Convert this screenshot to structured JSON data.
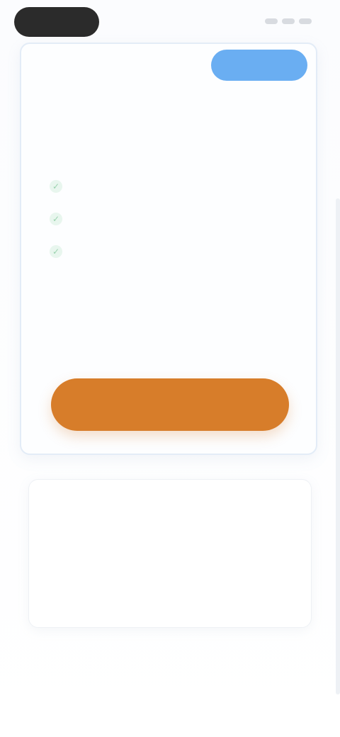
{
  "status_bar": {
    "time": "",
    "icons": [
      "signal-icon",
      "wifi-icon",
      "battery-icon"
    ]
  },
  "plan_card": {
    "label": "",
    "badge": "",
    "headline": "",
    "subline": "",
    "features": [
      {
        "icon": "check-icon",
        "text": ""
      },
      {
        "icon": "check-icon",
        "text": ""
      },
      {
        "icon": "check-icon",
        "text": ""
      }
    ],
    "cta_label": ""
  },
  "secondary_card": {
    "label": "",
    "title": "",
    "subtitle": ""
  },
  "footer": {
    "link_label": ""
  },
  "colors": {
    "accent_blue": "#6aaef2",
    "cta_orange": "#d77d2a",
    "check_green": "#9ad2ae",
    "text_dark": "#24344a"
  }
}
